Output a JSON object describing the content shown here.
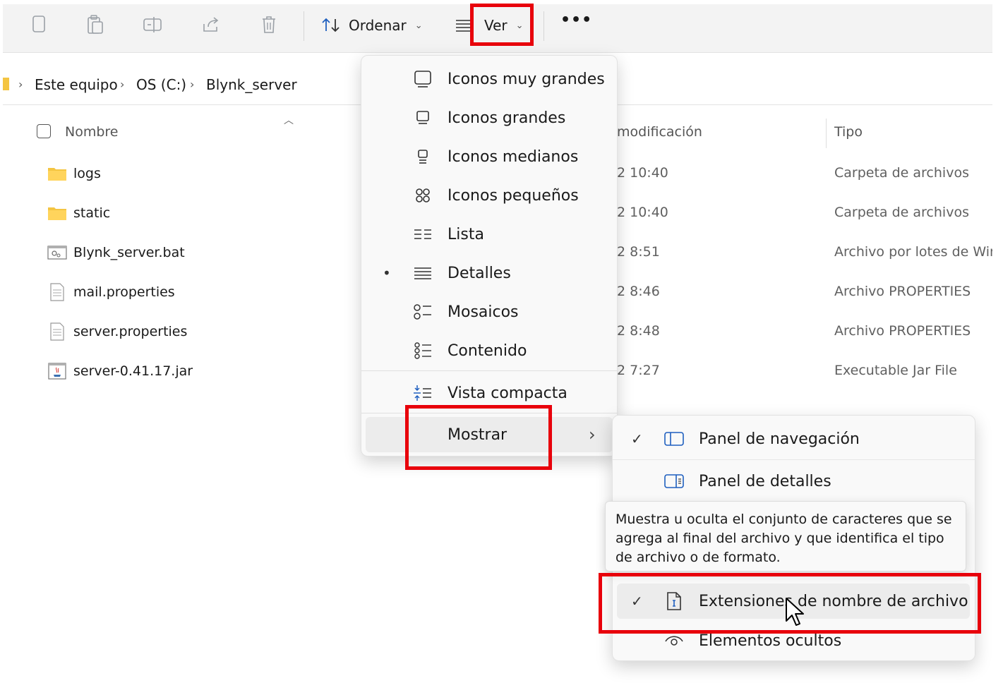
{
  "toolbar": {
    "icons": [
      "copy-icon",
      "paste-icon",
      "rename-icon",
      "share-icon",
      "delete-icon"
    ],
    "sort_label": "Ordenar",
    "view_label": "Ver",
    "more_label": "•••"
  },
  "address": {
    "crumbs": [
      "Este equipo",
      "OS (C:)",
      "Blynk_server"
    ]
  },
  "columns": {
    "name": "Nombre",
    "modified": "modificación",
    "type": "Tipo"
  },
  "files": [
    {
      "name": "logs",
      "modified": "2 10:40",
      "type": "Carpeta de archivos",
      "icon": "folder-icon"
    },
    {
      "name": "static",
      "modified": "2 10:40",
      "type": "Carpeta de archivos",
      "icon": "folder-icon"
    },
    {
      "name": "Blynk_server.bat",
      "modified": "2 8:51",
      "type": "Archivo por lotes de Win",
      "icon": "batch-file-icon"
    },
    {
      "name": "mail.properties",
      "modified": "2 8:46",
      "type": "Archivo PROPERTIES",
      "icon": "text-file-icon"
    },
    {
      "name": "server.properties",
      "modified": "2 8:48",
      "type": "Archivo PROPERTIES",
      "icon": "text-file-icon"
    },
    {
      "name": "server-0.41.17.jar",
      "modified": "2 7:27",
      "type": "Executable Jar File",
      "icon": "jar-file-icon"
    }
  ],
  "view_menu": {
    "items": [
      {
        "label": "Iconos muy grandes",
        "icon": "extra-large-icons-icon"
      },
      {
        "label": "Iconos grandes",
        "icon": "large-icons-icon"
      },
      {
        "label": "Iconos medianos",
        "icon": "medium-icons-icon"
      },
      {
        "label": "Iconos pequeños",
        "icon": "small-icons-icon"
      },
      {
        "label": "Lista",
        "icon": "list-view-icon"
      },
      {
        "label": "Detalles",
        "icon": "details-view-icon",
        "selected": true
      },
      {
        "label": "Mosaicos",
        "icon": "tiles-view-icon"
      },
      {
        "label": "Contenido",
        "icon": "content-view-icon"
      },
      {
        "label": "Vista compacta",
        "icon": "compact-view-icon"
      },
      {
        "label": "Mostrar",
        "icon": ""
      }
    ],
    "selected_bullet": "•",
    "submenu_arrow": "›"
  },
  "show_submenu": {
    "items": [
      {
        "label": "Panel de navegación",
        "checked": true,
        "icon": "navigation-pane-icon"
      },
      {
        "label": "Panel de detalles",
        "checked": false,
        "icon": "details-pane-icon"
      },
      {
        "label": "Extensiones de nombre de archivo",
        "checked": true,
        "icon": "file-extension-icon"
      },
      {
        "label": "Elementos ocultos",
        "checked": false,
        "icon": "hidden-items-icon"
      }
    ],
    "check_glyph": "✓"
  },
  "tooltip": {
    "text": "Muestra u oculta el conjunto de caracteres que se agrega al final del archivo y que identifica el tipo de archivo o de formato."
  },
  "colors": {
    "highlight_box": "#e8000b",
    "folder": "#f4c542",
    "toolbar_bg": "#f3f3f3"
  }
}
